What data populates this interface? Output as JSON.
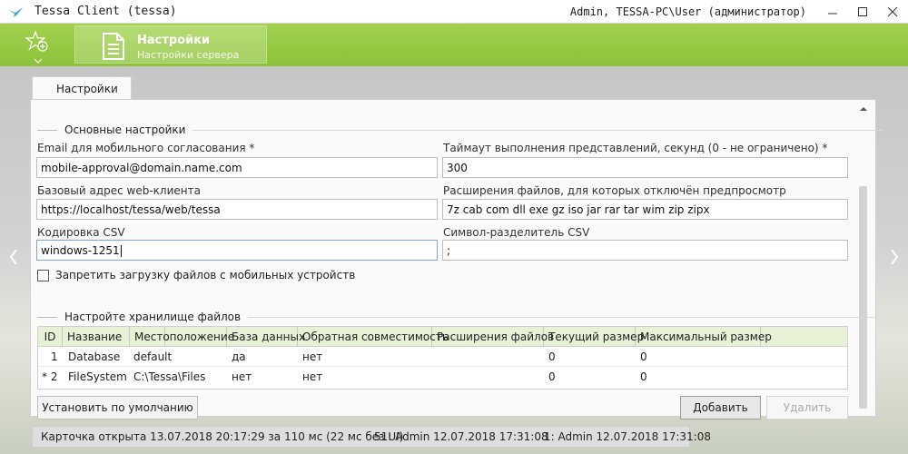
{
  "window": {
    "title": "Tessa Client (tessa)",
    "user": "Admin, TESSA-PC\\User (администратор)"
  },
  "ribbon": {
    "tile_title": "Настройки",
    "tile_subtitle": "Настройки сервера"
  },
  "tabs": [
    {
      "label": "Настройки",
      "active": true
    }
  ],
  "main_section": {
    "title": "Основные настройки",
    "email_label": "Email для мобильного согласования  *",
    "email_value": "mobile-approval@domain.name.com",
    "timeout_label": "Таймаут выполнения представлений, секунд (0 - не ограничено)  *",
    "timeout_value": "300",
    "base_url_label": "Базовый адрес web-клиента",
    "base_url_value": "https://localhost/tessa/web/tessa",
    "ext_label": "Расширения файлов, для которых отключён предпросмотр",
    "ext_value": "7z cab com dll exe gz iso jar rar tar wim zip zipx",
    "csv_encoding_label": "Кодировка CSV",
    "csv_encoding_value": "windows-1251",
    "csv_sep_label": "Символ-разделитель CSV",
    "csv_sep_value": ";",
    "mobile_upload_label": "Запретить загрузку файлов с мобильных устройств",
    "mobile_upload_checked": false
  },
  "storage_section": {
    "title": "Настройте хранилище файлов",
    "columns": [
      "ID",
      "Название",
      "Местоположение",
      "База данных",
      "Обратная совместимость",
      "Расширения файлов",
      "Текущий размер",
      "Максимальный размер"
    ],
    "rows": [
      {
        "id": "1",
        "name": "Database",
        "location": "default",
        "database": "да",
        "compat": "нет",
        "extensions": "",
        "current": "0",
        "max": "0"
      },
      {
        "id": "* 2",
        "name": "FileSystem",
        "location": "C:\\Tessa\\Files",
        "database": "нет",
        "compat": "нет",
        "extensions": "",
        "current": "0",
        "max": "0"
      }
    ],
    "default_button": "Установить по умолчанию",
    "add_button": "Добавить",
    "delete_button": "Удалить"
  },
  "status_bar": {
    "opened": "Карточка открыта 13.07.2018 20:17:29 за 110 мс (22 мс без UI)",
    "modified": "51:  Admin  12.07.2018 17:31:08",
    "created": "1:  Admin  12.07.2018 17:31:08"
  },
  "colors": {
    "ribbon": "#8cc23a",
    "grid_header": "#e7f1d6",
    "accent_blue": "#3aa7d8"
  },
  "icons": [
    "tessa-logo-icon",
    "minimize-icon",
    "maximize-icon",
    "close-icon",
    "favorites-add-icon",
    "chevron-down-icon",
    "document-icon",
    "chevron-left-icon",
    "chevron-right-icon",
    "scroll-up-icon",
    "checkbox-icon"
  ]
}
